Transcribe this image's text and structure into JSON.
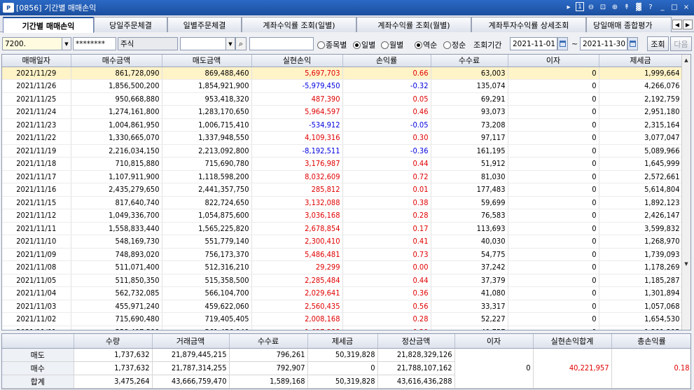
{
  "window": {
    "title": "[0856] 기간별 매매손익",
    "logo_text": "P"
  },
  "titlebar_controls": [
    "▸",
    "1",
    "⊖",
    "⊡",
    "⊕",
    "↟",
    "▓",
    "?",
    "_",
    "□",
    "×"
  ],
  "tabs": [
    {
      "label": "기간별 매매손익",
      "active": true
    },
    {
      "label": "당일주문체결"
    },
    {
      "label": "일별주문체결"
    },
    {
      "label": "계좌수익률 조회(일별)"
    },
    {
      "label": "계좌수익률 조회(월별)"
    },
    {
      "label": "계좌투자수익률 상세조회"
    },
    {
      "label": "당일매매 종합평가"
    }
  ],
  "toolbar": {
    "account_no": "7200.",
    "password": "********",
    "product": "주식",
    "stock_code": "",
    "stock_name": "",
    "radio_by_stock": "종목별",
    "radio_daily": "일별",
    "radio_monthly": "월별",
    "radio_desc": "역순",
    "radio_asc": "정순",
    "period_label": "조회기간",
    "date_from": "2021-11-01",
    "date_sep": "~",
    "date_to": "2021-11-30",
    "query_button": "조회",
    "next_button": "다음"
  },
  "grid": {
    "columns": [
      "매매일자",
      "매수금액",
      "매도금액",
      "실현손익",
      "손익률",
      "수수료",
      "이자",
      "제세금"
    ],
    "rows": [
      [
        "2021/11/29",
        "861,728,090",
        "869,488,460",
        "5,697,703",
        "0.66",
        "63,003",
        "0",
        "1,999,664"
      ],
      [
        "2021/11/26",
        "1,856,500,200",
        "1,854,921,900",
        "-5,979,450",
        "-0.32",
        "135,074",
        "0",
        "4,266,076"
      ],
      [
        "2021/11/25",
        "950,668,880",
        "953,418,320",
        "487,390",
        "0.05",
        "69,291",
        "0",
        "2,192,759"
      ],
      [
        "2021/11/24",
        "1,274,161,800",
        "1,283,170,650",
        "5,964,597",
        "0.46",
        "93,073",
        "0",
        "2,951,180"
      ],
      [
        "2021/11/23",
        "1,004,861,950",
        "1,006,715,410",
        "-534,912",
        "-0.05",
        "73,208",
        "0",
        "2,315,164"
      ],
      [
        "2021/11/22",
        "1,330,665,070",
        "1,337,948,550",
        "4,109,316",
        "0.30",
        "97,117",
        "0",
        "3,077,047"
      ],
      [
        "2021/11/19",
        "2,216,034,150",
        "2,213,092,800",
        "-8,192,511",
        "-0.36",
        "161,195",
        "0",
        "5,089,966"
      ],
      [
        "2021/11/18",
        "710,815,880",
        "715,690,780",
        "3,176,987",
        "0.44",
        "51,912",
        "0",
        "1,645,999"
      ],
      [
        "2021/11/17",
        "1,107,911,900",
        "1,118,598,200",
        "8,032,609",
        "0.72",
        "81,030",
        "0",
        "2,572,661"
      ],
      [
        "2021/11/16",
        "2,435,279,650",
        "2,441,357,750",
        "285,812",
        "0.01",
        "177,483",
        "0",
        "5,614,804"
      ],
      [
        "2021/11/15",
        "817,640,740",
        "822,724,650",
        "3,132,088",
        "0.38",
        "59,699",
        "0",
        "1,892,123"
      ],
      [
        "2021/11/12",
        "1,049,336,700",
        "1,054,875,600",
        "3,036,168",
        "0.28",
        "76,583",
        "0",
        "2,426,147"
      ],
      [
        "2021/11/11",
        "1,558,833,440",
        "1,565,225,820",
        "2,678,854",
        "0.17",
        "113,693",
        "0",
        "3,599,832"
      ],
      [
        "2021/11/10",
        "548,169,730",
        "551,779,140",
        "2,300,410",
        "0.41",
        "40,030",
        "0",
        "1,268,970"
      ],
      [
        "2021/11/09",
        "748,893,020",
        "756,173,370",
        "5,486,481",
        "0.73",
        "54,775",
        "0",
        "1,739,093"
      ],
      [
        "2021/11/08",
        "511,071,400",
        "512,316,210",
        "29,299",
        "0.00",
        "37,242",
        "0",
        "1,178,269"
      ],
      [
        "2021/11/05",
        "511,850,350",
        "515,358,500",
        "2,285,484",
        "0.44",
        "37,379",
        "0",
        "1,185,287"
      ],
      [
        "2021/11/04",
        "562,732,085",
        "566,104,700",
        "2,029,641",
        "0.36",
        "41,080",
        "0",
        "1,301,894"
      ],
      [
        "2021/11/03",
        "455,971,240",
        "459,622,060",
        "2,560,435",
        "0.56",
        "33,317",
        "0",
        "1,057,068"
      ],
      [
        "2021/11/02",
        "715,690,480",
        "719,405,405",
        "2,008,168",
        "0.28",
        "52,227",
        "0",
        "1,654,530"
      ],
      [
        "2021/11/01",
        "558,497,500",
        "561,456,940",
        "1,627,388",
        "0.29",
        "40,757",
        "0",
        "1,291,295"
      ]
    ]
  },
  "summary": {
    "columns": [
      "",
      "수량",
      "거래금액",
      "수수료",
      "제세금",
      "정산금액",
      "이자",
      "실현손익합계",
      "총손익률"
    ],
    "rows": [
      {
        "label": "매도",
        "qty": "1,737,632",
        "amount": "21,879,445,215",
        "fee": "796,261",
        "tax": "50,319,828",
        "settle": "21,828,329,126"
      },
      {
        "label": "매수",
        "qty": "1,737,632",
        "amount": "21,787,314,255",
        "fee": "792,907",
        "tax": "0",
        "settle": "21,788,107,162"
      },
      {
        "label": "합계",
        "qty": "3,475,264",
        "amount": "43,666,759,470",
        "fee": "1,589,168",
        "tax": "50,319,828",
        "settle": "43,616,436,288"
      }
    ],
    "interest": "0",
    "realized_total": "40,221,957",
    "total_rate": "0.18"
  },
  "colors": {
    "positive": "#e00000",
    "negative": "#0000e0",
    "selected_row": "#fff3c8",
    "titlebar": "#1b4f9e"
  }
}
